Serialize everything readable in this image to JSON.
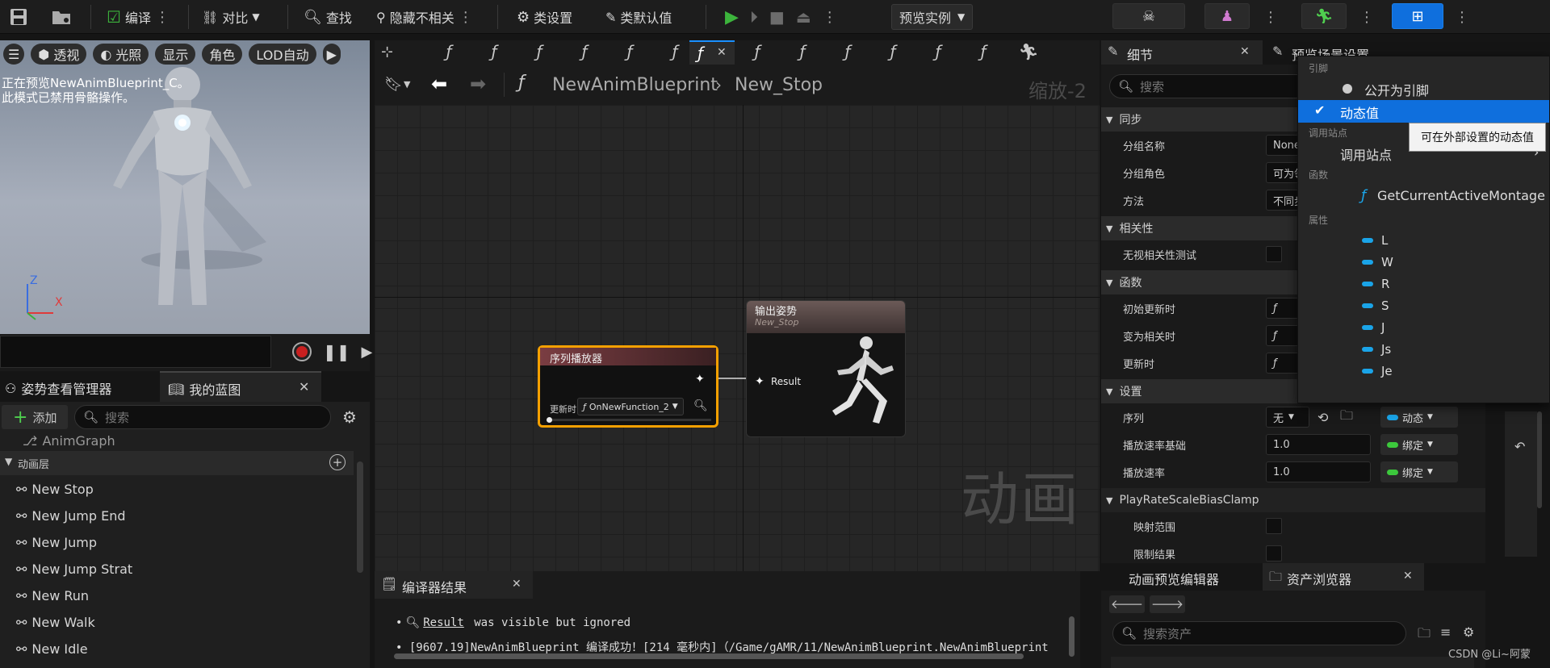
{
  "toolbar": {
    "compile": "编译",
    "diff": "对比",
    "find": "查找",
    "hide_unrelated": "隐藏不相关",
    "class_settings": "类设置",
    "class_defaults": "类默认值",
    "preview_instance": "预览实例"
  },
  "viewport": {
    "perspective": "透视",
    "lighting": "光照",
    "show": "显示",
    "character": "角色",
    "lod": "LOD自动",
    "msg1": "正在预览NewAnimBlueprint_C。",
    "msg2": "此模式已禁用骨骼操作。",
    "axis_z": "Z",
    "axis_x": "X"
  },
  "left_panel": {
    "tab_pose": "姿势查看管理器",
    "tab_blueprint": "我的蓝图",
    "add": "添加",
    "search_placeholder": "搜索",
    "animgraph": "AnimGraph",
    "section_layers": "动画层",
    "items": [
      "New Stop",
      "New Jump End",
      "New Jump",
      "New Jump Strat",
      "New Run",
      "New Walk",
      "New Idle"
    ]
  },
  "graph": {
    "func_glyph": "ƒ",
    "crumb_root": "NewAnimBlueprint",
    "crumb_leaf": "New_Stop",
    "zoom": "缩放-2",
    "watermark": "动画",
    "node_seq_title": "序列播放器",
    "node_seq_update_label": "更新时",
    "node_seq_update_value": "OnNewFunction_2",
    "node_out_title": "输出姿势",
    "node_out_sub": "New_Stop",
    "node_out_pin": "Result"
  },
  "compiler": {
    "tab": "编译器结果",
    "line1_link": "Result",
    "line1_text": " was visible but ignored",
    "line2": "[9607.19]NewAnimBlueprint 编译成功！[214 毫秒内]（/Game/gAMR/11/NewAnimBlueprint.NewAnimBlueprint"
  },
  "details": {
    "tab": "细节",
    "tab2": "预览场景设置",
    "search_placeholder": "搜索",
    "sec_sync": "同步",
    "group_name": "分组名称",
    "group_name_val": "None",
    "group_role": "分组角色",
    "group_role_val": "可为领",
    "method": "方法",
    "method_val": "不同步",
    "sec_relevancy": "相关性",
    "ignore_relevancy": "无视相关性测试",
    "sec_functions": "函数",
    "init_update": "初始更新时",
    "become_relevant": "变为相关时",
    "on_update": "更新时",
    "sec_settings": "设置",
    "sequence": "序列",
    "sequence_val": "无",
    "dynamic": "动态",
    "play_rate_basis": "播放速率基础",
    "play_rate_basis_val": "1.0",
    "bind": "绑定",
    "play_rate": "播放速率",
    "play_rate_val": "1.0",
    "sec_clamp": "PlayRateScaleBiasClamp",
    "map_range": "映射范围",
    "clamp_result": "限制结果"
  },
  "assets": {
    "tab_anim_editor": "动画预览编辑器",
    "tab_browser": "资产浏览器",
    "search_placeholder": "搜索资产",
    "credit": "CSDN @Li~阿蒙"
  },
  "popup": {
    "sec_pin": "引脚",
    "expose_pin": "公开为引脚",
    "dynamic_value": "动态值",
    "sec_callsite": "调用站点",
    "call_site": "调用站点",
    "sec_functions": "函数",
    "function": "GetCurrentActiveMontage",
    "sec_props": "属性",
    "vars": [
      "L",
      "W",
      "R",
      "S",
      "J",
      "Js",
      "Je"
    ],
    "tooltip": "可在外部设置的动态值"
  }
}
